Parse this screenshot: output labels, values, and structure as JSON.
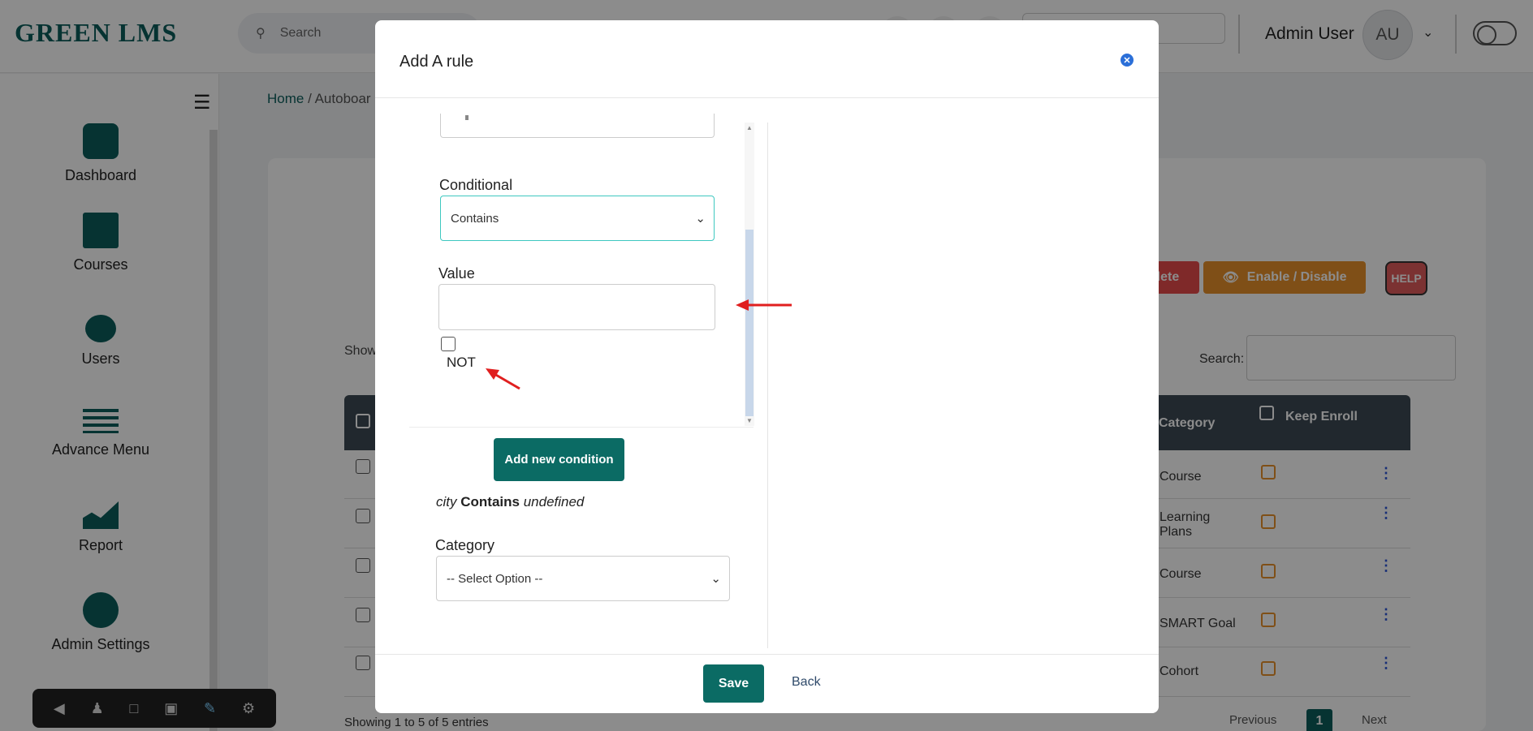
{
  "header": {
    "logo": "GREEN LMS",
    "search_placeholder": "Search",
    "admin_name": "Admin User",
    "avatar_initials": "AU"
  },
  "sidebar": {
    "items": [
      {
        "label": "Dashboard",
        "icon": "dashboard-icon"
      },
      {
        "label": "Courses",
        "icon": "book-icon"
      },
      {
        "label": "Users",
        "icon": "users-icon"
      },
      {
        "label": "Advance Menu",
        "icon": "menu-icon"
      },
      {
        "label": "Report",
        "icon": "chart-icon"
      },
      {
        "label": "Admin Settings",
        "icon": "gear-icon"
      }
    ]
  },
  "page": {
    "breadcrumb_home": "Home",
    "breadcrumb_current": "Autoboar",
    "delete_label": "lete",
    "enable_disable_label": "Enable / Disable",
    "help_label": "HELP",
    "show_label": "Show",
    "search_label": "Search:",
    "table": {
      "col_category": "Category",
      "col_keep_enroll": "Keep Enroll",
      "rows": [
        {
          "category": "Course"
        },
        {
          "category": "Learning Plans"
        },
        {
          "category": "Course"
        },
        {
          "category": "SMART Goal"
        },
        {
          "category": "Cohort"
        }
      ]
    },
    "showing_text": "Showing 1 to 5 of 5 entries",
    "pagination": {
      "previous": "Previous",
      "current": "1",
      "next": "Next"
    }
  },
  "modal": {
    "title": "Add A rule",
    "conditional_label": "Conditional",
    "conditional_value": "Contains",
    "value_label": "Value",
    "value_input": "",
    "not_label": "NOT",
    "add_condition_label": "Add new condition",
    "summary": {
      "field": "city",
      "op": "Contains",
      "value": "undefined"
    },
    "category_label": "Category",
    "category_value": "-- Select Option --",
    "save_label": "Save",
    "back_label": "Back"
  },
  "colors": {
    "brand": "#0b5e5c",
    "annotation_arrow": "#e01f1f",
    "focus_border": "#3ec8c0"
  }
}
